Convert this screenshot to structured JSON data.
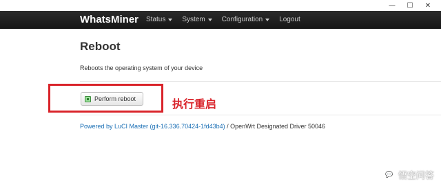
{
  "window": {
    "minimize": "—",
    "maximize": "☐",
    "close": "✕"
  },
  "navbar": {
    "brand": "WhatsMiner",
    "items": [
      {
        "label": "Status",
        "dropdown": true
      },
      {
        "label": "System",
        "dropdown": true
      },
      {
        "label": "Configuration",
        "dropdown": true
      },
      {
        "label": "Logout",
        "dropdown": false
      }
    ]
  },
  "page": {
    "title": "Reboot",
    "description": "Reboots the operating system of your device",
    "button_label": "Perform reboot"
  },
  "annotation": {
    "text": "执行重启",
    "color": "#d9232a"
  },
  "footer": {
    "link_text": "Powered by LuCI Master (git-16.336.70424-1fd43b4)",
    "text": " / OpenWrt Designated Driver 50046"
  },
  "watermark": {
    "text": "悟空问答"
  },
  "colors": {
    "navbar": "#1c1c1c",
    "link": "#1a6fb5",
    "accent_red": "#d9232a"
  }
}
